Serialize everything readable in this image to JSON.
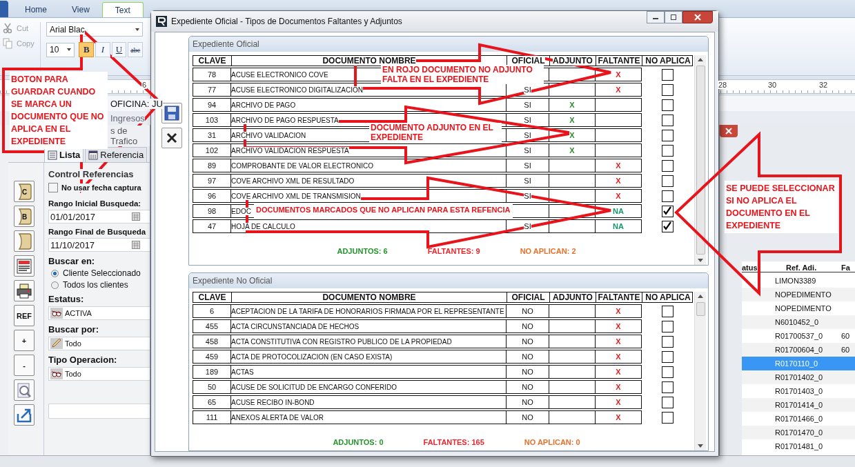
{
  "app": {
    "ribbon_tabs": [
      {
        "label": "Home",
        "selected": false
      },
      {
        "label": "View",
        "selected": false
      },
      {
        "label": "Text",
        "selected": true
      }
    ],
    "clipboard": [
      {
        "kind": "cut",
        "label": "Cut",
        "disabled": true
      },
      {
        "kind": "copy",
        "label": "Copy",
        "disabled": true
      }
    ],
    "font_name": "Arial Blac",
    "font_size": "10",
    "format_buttons": [
      {
        "label": "B",
        "selected": true
      },
      {
        "label": "I",
        "selected": false
      },
      {
        "label": "U",
        "selected": false
      },
      {
        "label": "abc",
        "selected": false
      }
    ],
    "ruler": [
      "6",
      "28",
      "30",
      "32"
    ],
    "info_text": "OFICINA: JU",
    "tab_fragment": "Ingresos",
    "window_fragment": "s de Trafico",
    "panel_tabs": [
      {
        "label": "Lista",
        "selected": true
      },
      {
        "label": "Referencia",
        "selected": false
      }
    ],
    "toolbar": [
      {
        "kind": "scroll",
        "label": "C"
      },
      {
        "kind": "scroll",
        "label": "B"
      },
      {
        "kind": "scroll"
      },
      {
        "kind": "report"
      },
      {
        "kind": "printer"
      },
      {
        "kind": "text",
        "label": "REF"
      },
      {
        "kind": "text",
        "label": "+"
      },
      {
        "kind": "text",
        "label": "-"
      },
      {
        "kind": "preview"
      },
      {
        "kind": "export"
      }
    ],
    "group_title": "Control Referencias",
    "no_date": {
      "label": "No usar fecha captura",
      "checked": false
    },
    "dates": [
      {
        "label": "Rango Inicial Busqueda:",
        "value": "01/01/2017"
      },
      {
        "label": "Rango Final de Busqueda",
        "value": "11/10/2017"
      }
    ],
    "search_in": {
      "label": "Buscar en:",
      "options": [
        {
          "label": "Cliente Seleccionado",
          "selected": true
        },
        {
          "label": "Todos los clientes",
          "selected": false
        }
      ]
    },
    "selects": [
      {
        "label": "Estatus:",
        "value": "ACTIVA"
      },
      {
        "label": "Buscar por:",
        "value": "Todo"
      },
      {
        "label": "Tipo Operacion:",
        "value": "Todo"
      }
    ],
    "grid": {
      "columns": [
        "atus",
        "Ref. Adi.",
        "Fa"
      ],
      "rows": [
        {
          "ref": "LIMON3389",
          "selected": false
        },
        {
          "ref": "NOPEDIMENTO",
          "selected": false
        },
        {
          "ref": "NOPEDIMENTO",
          "selected": false
        },
        {
          "ref": "N6010452_0",
          "selected": false
        },
        {
          "ref": "R01700537_0",
          "column_3": "60",
          "selected": false
        },
        {
          "ref": "R01700604_0",
          "column_3": "60",
          "selected": false
        },
        {
          "ref": "R0170110_0",
          "selected": true
        },
        {
          "ref": "R01701402_0",
          "selected": false
        },
        {
          "ref": "R01701403_0",
          "selected": false
        },
        {
          "ref": "R01701414_0",
          "selected": false
        },
        {
          "ref": "R01701466_0",
          "selected": false
        },
        {
          "ref": "R01701470_0",
          "selected": false
        },
        {
          "ref": "R01701481_0",
          "selected": false
        }
      ]
    }
  },
  "dialog": {
    "title": "Expediente Oficial - Tipos de Documentos Faltantes y Adjuntos",
    "sections": [
      {
        "title": "Expediente Oficial",
        "columns": [
          "CLAVE",
          "DOCUMENTO NOMBRE",
          "OFICIAL",
          "ADJUNTO",
          "FALTANTE",
          "NO APLICA"
        ],
        "rows": [
          {
            "clave": "78",
            "nombre": "ACUSE ELECTRONICO COVE",
            "faltante": "X",
            "no_aplica": false
          },
          {
            "clave": "77",
            "nombre": "ACUSE ELECTRONICO DIGITALIZACION",
            "oficial": "SI",
            "faltante": "X",
            "no_aplica": false
          },
          {
            "clave": "94",
            "nombre": "ARCHIVO DE PAGO",
            "oficial": "SI",
            "adjunto": "X",
            "no_aplica": false
          },
          {
            "clave": "103",
            "nombre": "ARCHIVO DE PAGO RESPUESTA",
            "oficial": "SI",
            "adjunto": "X",
            "no_aplica": false
          },
          {
            "clave": "31",
            "nombre": "ARCHIVO VALIDACION",
            "oficial": "SI",
            "adjunto": "X",
            "no_aplica": false
          },
          {
            "clave": "102",
            "nombre": "ARCHIVO VALIDACION RESPUESTA",
            "oficial": "SI",
            "adjunto": "X",
            "no_aplica": false
          },
          {
            "clave": "89",
            "nombre": "COMPROBANTE DE VALOR ELECTRONICO",
            "oficial": "SI",
            "faltante": "X",
            "no_aplica": false
          },
          {
            "clave": "97",
            "nombre": "COVE ARCHIVO XML DE RESULTADO",
            "oficial": "SI",
            "faltante": "X",
            "no_aplica": false
          },
          {
            "clave": "96",
            "nombre": "COVE ARCHIVO XML DE TRANSMISION",
            "oficial": "SI",
            "faltante": "X",
            "no_aplica": false
          },
          {
            "clave": "98",
            "nombre": "EDOC",
            "faltante": "NA",
            "no_aplica": true
          },
          {
            "clave": "47",
            "nombre": "HOJA DE CALCULO",
            "oficial": "SI",
            "faltante": "NA",
            "no_aplica": true
          }
        ],
        "totals": {
          "adjuntos": "ADJUNTOS: 6",
          "faltantes": "FALTANTES: 9",
          "no_aplican": "NO APLICAN: 2"
        }
      },
      {
        "title": "Expediente No Oficial",
        "columns": [
          "CLAVE",
          "DOCUMENTO NOMBRE",
          "OFICIAL",
          "ADJUNTO",
          "FALTANTE",
          "NO APLICA"
        ],
        "rows": [
          {
            "clave": "6",
            "nombre": "ACEPTACION DE LA TARIFA DE HONORARIOS FIRMADA POR EL REPRESENTANTE",
            "oficial": "NO",
            "faltante": "X",
            "no_aplica": false
          },
          {
            "clave": "455",
            "nombre": "ACTA CIRCUNSTANCIADA DE HECHOS",
            "oficial": "NO",
            "faltante": "X",
            "no_aplica": false
          },
          {
            "clave": "458",
            "nombre": "ACTA CONSTITUTIVA CON REGISTRO PUBLICO DE LA PROPIEDAD",
            "oficial": "NO",
            "faltante": "X",
            "no_aplica": false
          },
          {
            "clave": "459",
            "nombre": "ACTA DE PROTOCOLIZACION (EN CASO EXISTA)",
            "oficial": "NO",
            "faltante": "X",
            "no_aplica": false
          },
          {
            "clave": "189",
            "nombre": "ACTAS",
            "oficial": "NO",
            "faltante": "X",
            "no_aplica": false
          },
          {
            "clave": "50",
            "nombre": "ACUSE DE SOLICITUD DE ENCARGO CONFERIDO",
            "oficial": "NO",
            "faltante": "X",
            "no_aplica": false
          },
          {
            "clave": "65",
            "nombre": "ACUSE RECIBO IN-BOND",
            "oficial": "NO",
            "faltante": "X",
            "no_aplica": false
          },
          {
            "clave": "111",
            "nombre": "ANEXOS ALERTA DE VALOR",
            "oficial": "NO",
            "faltante": "X",
            "no_aplica": false
          }
        ],
        "totals": {
          "adjuntos": "ADJUNTOS: 0",
          "faltantes": "FALTANTES: 165",
          "no_aplican": "NO APLICAN: 0"
        }
      }
    ]
  },
  "callouts": [
    {
      "text": "BOTON PARA GUARDAR CUANDO SE MARCA UN DOCUMENTO QUE NO APLICA EN EL EXPEDIENTE"
    },
    {
      "text": "EN ROJO DOCUMENTO NO ADJUNTO FALTA EN EL EXPEDIENTE"
    },
    {
      "text": "DOCUMENTO ADJUNTO EN EL EXPEDIENTE"
    },
    {
      "text": "DOCUMENTOS MARCADOS QUE NO APLICAN PARA ESTA REFENCIA"
    },
    {
      "text": "SE PUEDE SELECCIONAR SI NO APLICA EL DOCUMENTO EN EL EXPEDIENTE"
    }
  ]
}
